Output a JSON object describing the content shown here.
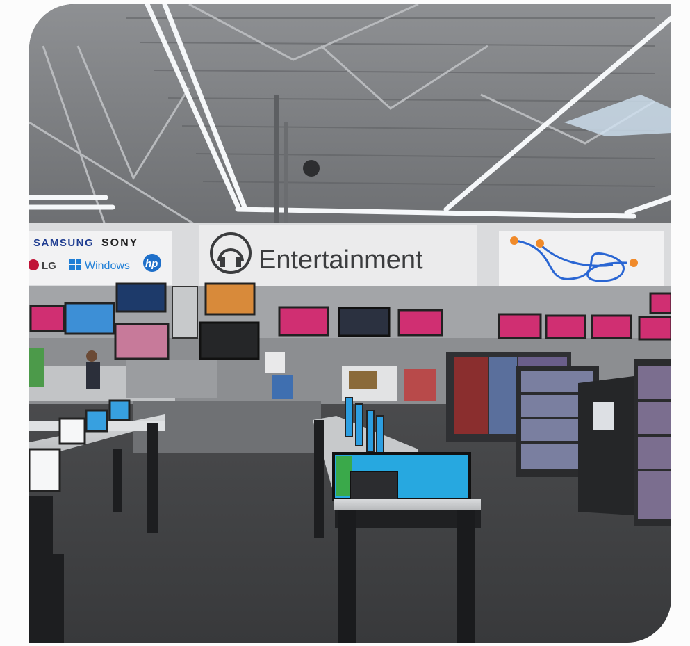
{
  "signage": {
    "department": "Entertainment",
    "brands": [
      "SAMSUNG",
      "SONY",
      "LG",
      "Windows",
      "hp"
    ]
  },
  "colors": {
    "ceiling": "#7d7f82",
    "floor": "#3b3c3e",
    "sign_bg": "#e9e9ea",
    "samsung_blue": "#1f3d91",
    "windows_blue": "#1e7ed6",
    "lg_red": "#c01437",
    "screen_magenta": "#d02f72",
    "cable_blue": "#2a66d3"
  },
  "icons": [
    "headphones-icon",
    "lg-logo-icon",
    "windows-logo-icon",
    "hp-logo-icon"
  ]
}
